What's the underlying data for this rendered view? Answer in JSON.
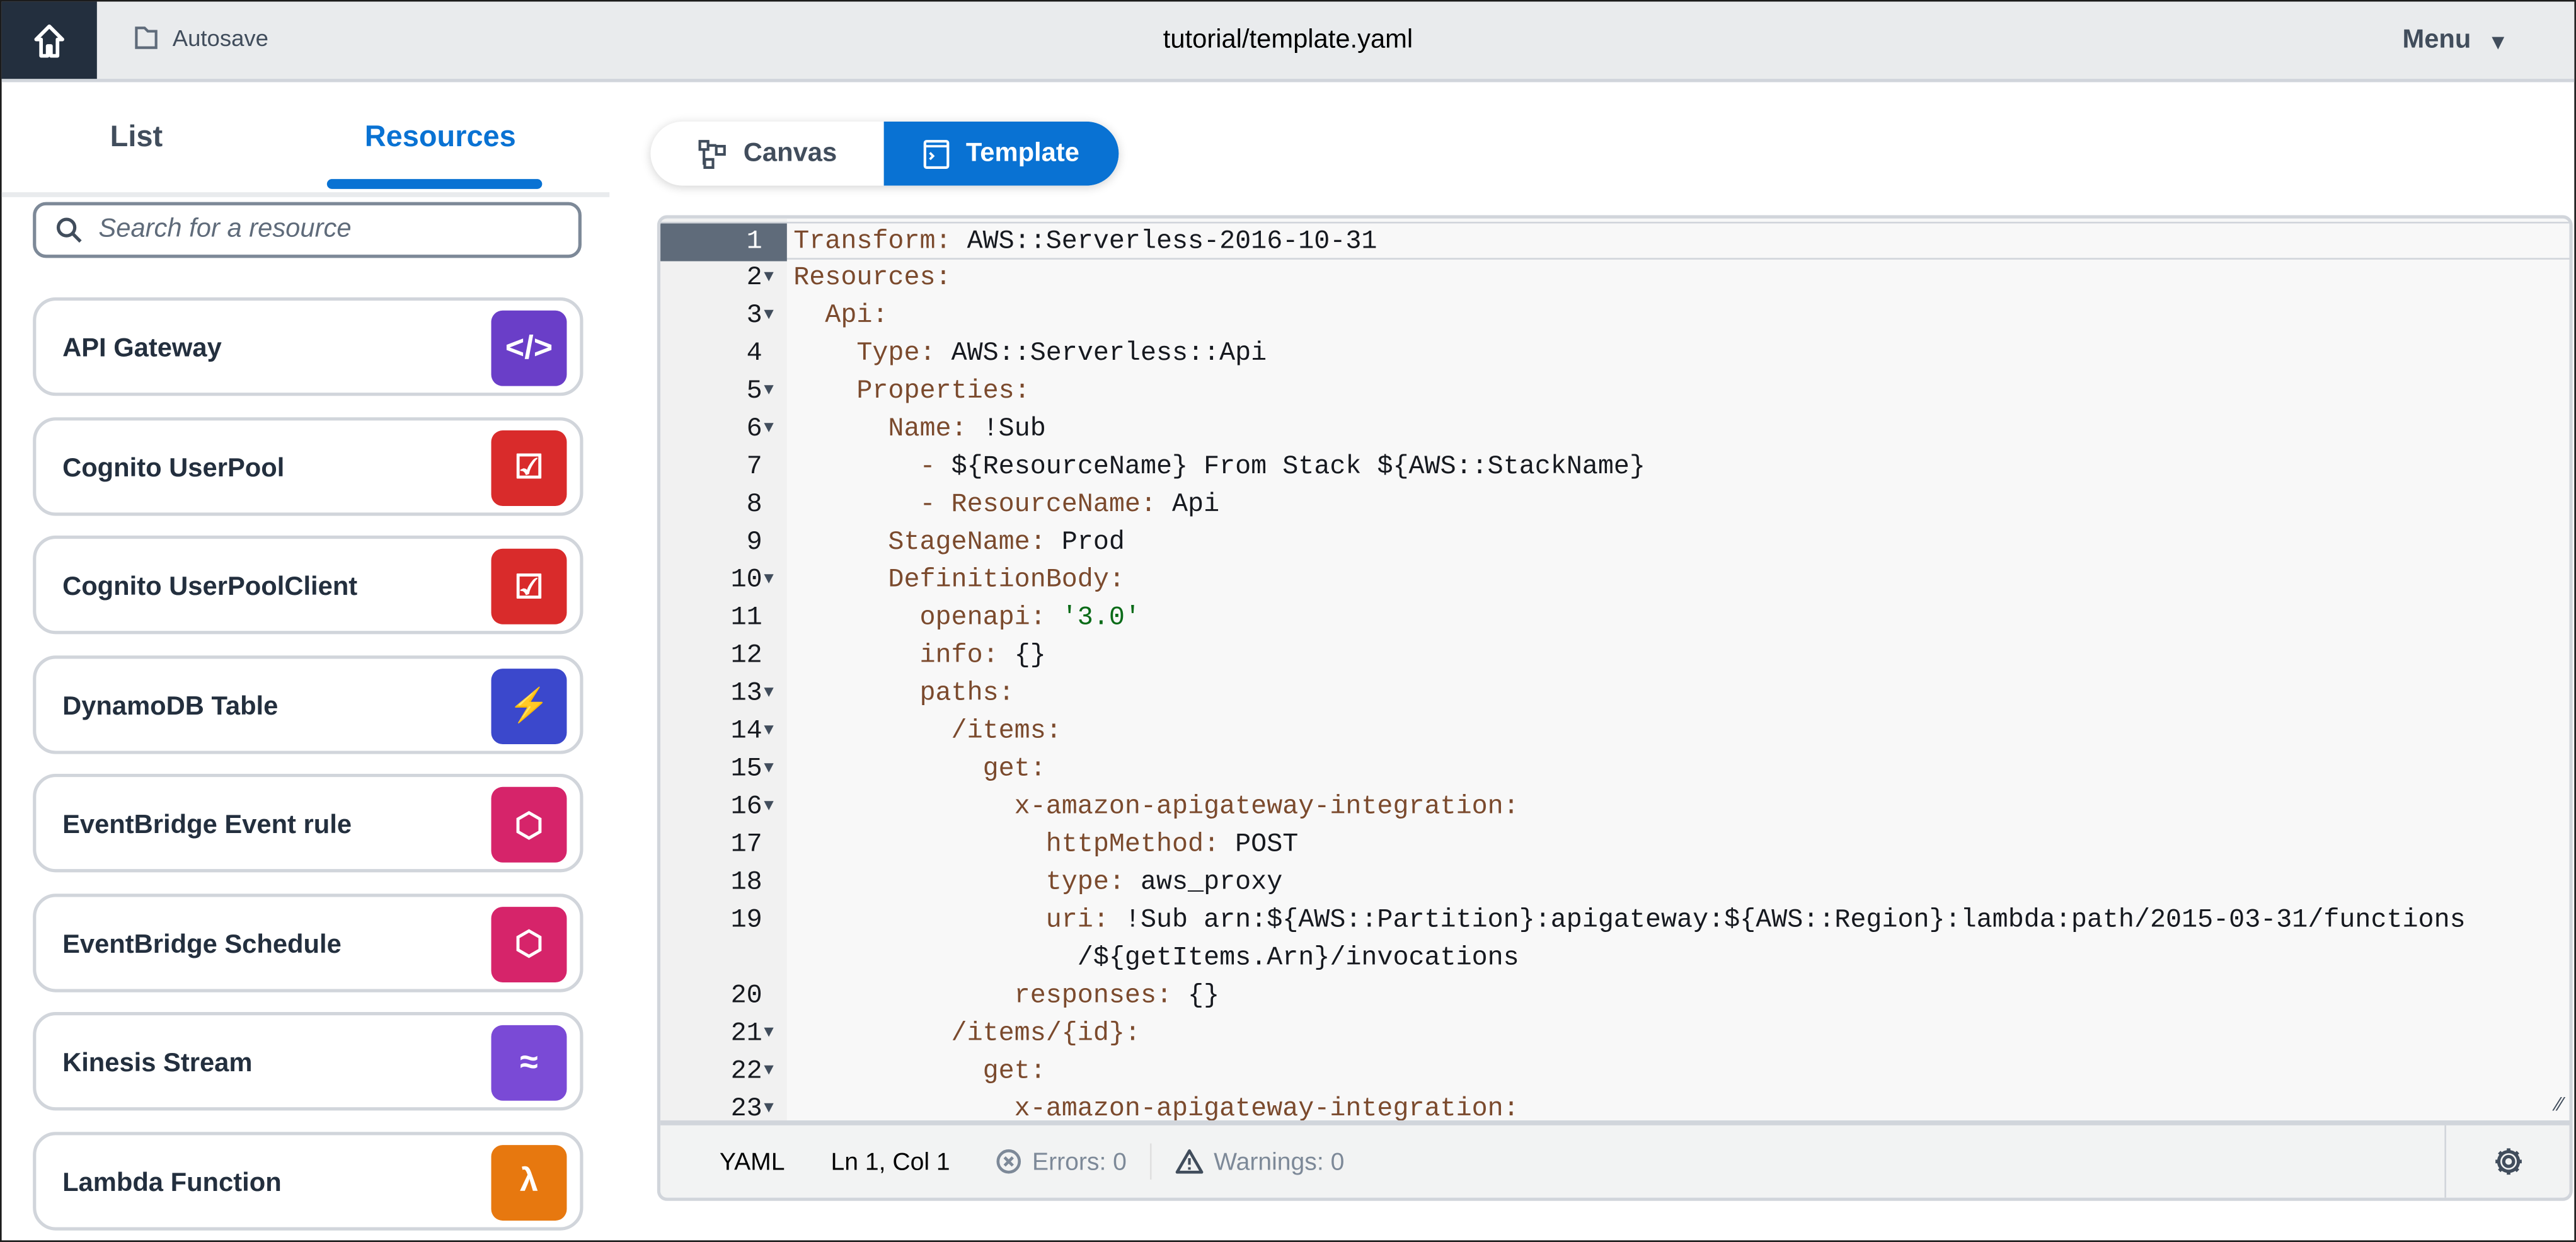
{
  "header": {
    "home_icon": "home-icon",
    "autosave": "Autosave",
    "title": "tutorial/template.yaml",
    "menu": "Menu"
  },
  "sidebar": {
    "tabs": [
      {
        "label": "List",
        "active": false
      },
      {
        "label": "Resources",
        "active": true
      }
    ],
    "search_placeholder": "Search for a resource",
    "items": [
      {
        "label": "API Gateway",
        "icon": "api-gateway-icon",
        "color": "#6a3ec8"
      },
      {
        "label": "Cognito UserPool",
        "icon": "cognito-icon",
        "color": "#d92b2b"
      },
      {
        "label": "Cognito UserPoolClient",
        "icon": "cognito-icon",
        "color": "#d92b2b"
      },
      {
        "label": "DynamoDB Table",
        "icon": "dynamodb-icon",
        "color": "#3b48cc"
      },
      {
        "label": "EventBridge Event rule",
        "icon": "eventbridge-icon",
        "color": "#d6246a"
      },
      {
        "label": "EventBridge Schedule",
        "icon": "eventbridge-icon",
        "color": "#d6246a"
      },
      {
        "label": "Kinesis Stream",
        "icon": "kinesis-icon",
        "color": "#7a4ad6"
      },
      {
        "label": "Lambda Function",
        "icon": "lambda-icon",
        "color": "#e7780f"
      }
    ]
  },
  "view_toggle": {
    "canvas": "Canvas",
    "template": "Template",
    "active": "Template"
  },
  "editor": {
    "lines": [
      {
        "n": "1",
        "fold": false,
        "parts": [
          [
            "k",
            "Transform:"
          ],
          [
            "v",
            " AWS::Serverless-2016-10-31"
          ]
        ]
      },
      {
        "n": "2",
        "fold": true,
        "parts": [
          [
            "k",
            "Resources:"
          ]
        ]
      },
      {
        "n": "3",
        "fold": true,
        "parts": [
          [
            "v",
            "  "
          ],
          [
            "k",
            "Api:"
          ]
        ]
      },
      {
        "n": "4",
        "fold": false,
        "parts": [
          [
            "v",
            "    "
          ],
          [
            "k",
            "Type:"
          ],
          [
            "v",
            " AWS::Serverless::Api"
          ]
        ]
      },
      {
        "n": "5",
        "fold": true,
        "parts": [
          [
            "v",
            "    "
          ],
          [
            "k",
            "Properties:"
          ]
        ]
      },
      {
        "n": "6",
        "fold": true,
        "parts": [
          [
            "v",
            "      "
          ],
          [
            "k",
            "Name:"
          ],
          [
            "v",
            " !Sub"
          ]
        ]
      },
      {
        "n": "7",
        "fold": false,
        "parts": [
          [
            "v",
            "        "
          ],
          [
            "k",
            "-"
          ],
          [
            "v",
            " ${ResourceName} From Stack ${AWS::StackName}"
          ]
        ]
      },
      {
        "n": "8",
        "fold": false,
        "parts": [
          [
            "v",
            "        "
          ],
          [
            "k",
            "- ResourceName:"
          ],
          [
            "v",
            " Api"
          ]
        ]
      },
      {
        "n": "9",
        "fold": false,
        "parts": [
          [
            "v",
            "      "
          ],
          [
            "k",
            "StageName:"
          ],
          [
            "v",
            " Prod"
          ]
        ]
      },
      {
        "n": "10",
        "fold": true,
        "parts": [
          [
            "v",
            "      "
          ],
          [
            "k",
            "DefinitionBody:"
          ]
        ]
      },
      {
        "n": "11",
        "fold": false,
        "parts": [
          [
            "v",
            "        "
          ],
          [
            "k",
            "openapi:"
          ],
          [
            "s",
            " '3.0'"
          ]
        ]
      },
      {
        "n": "12",
        "fold": false,
        "parts": [
          [
            "v",
            "        "
          ],
          [
            "k",
            "info:"
          ],
          [
            "v",
            " {}"
          ]
        ]
      },
      {
        "n": "13",
        "fold": true,
        "parts": [
          [
            "v",
            "        "
          ],
          [
            "k",
            "paths:"
          ]
        ]
      },
      {
        "n": "14",
        "fold": true,
        "parts": [
          [
            "v",
            "          "
          ],
          [
            "k",
            "/items:"
          ]
        ]
      },
      {
        "n": "15",
        "fold": true,
        "parts": [
          [
            "v",
            "            "
          ],
          [
            "k",
            "get:"
          ]
        ]
      },
      {
        "n": "16",
        "fold": true,
        "parts": [
          [
            "v",
            "              "
          ],
          [
            "k",
            "x-amazon-apigateway-integration:"
          ]
        ]
      },
      {
        "n": "17",
        "fold": false,
        "parts": [
          [
            "v",
            "                "
          ],
          [
            "k",
            "httpMethod:"
          ],
          [
            "v",
            " POST"
          ]
        ]
      },
      {
        "n": "18",
        "fold": false,
        "parts": [
          [
            "v",
            "                "
          ],
          [
            "k",
            "type:"
          ],
          [
            "v",
            " aws_proxy"
          ]
        ]
      },
      {
        "n": "19",
        "fold": false,
        "parts": [
          [
            "v",
            "                "
          ],
          [
            "k",
            "uri:"
          ],
          [
            "v",
            " !Sub arn:${AWS::Partition}:apigateway:${AWS::Region}:lambda:path/2015-03-31/functions"
          ]
        ]
      },
      {
        "n": "",
        "fold": false,
        "parts": [
          [
            "v",
            "                  /${getItems.Arn}/invocations"
          ]
        ]
      },
      {
        "n": "20",
        "fold": false,
        "parts": [
          [
            "v",
            "              "
          ],
          [
            "k",
            "responses:"
          ],
          [
            "v",
            " {}"
          ]
        ]
      },
      {
        "n": "21",
        "fold": true,
        "parts": [
          [
            "v",
            "          "
          ],
          [
            "k",
            "/items/{id}:"
          ]
        ]
      },
      {
        "n": "22",
        "fold": true,
        "parts": [
          [
            "v",
            "            "
          ],
          [
            "k",
            "get:"
          ]
        ]
      },
      {
        "n": "23",
        "fold": true,
        "parts": [
          [
            "v",
            "              "
          ],
          [
            "k",
            "x-amazon-apigateway-integration:"
          ]
        ]
      }
    ],
    "status": {
      "language": "YAML",
      "position": "Ln 1, Col 1",
      "errors": "Errors: 0",
      "warnings": "Warnings: 0"
    }
  }
}
